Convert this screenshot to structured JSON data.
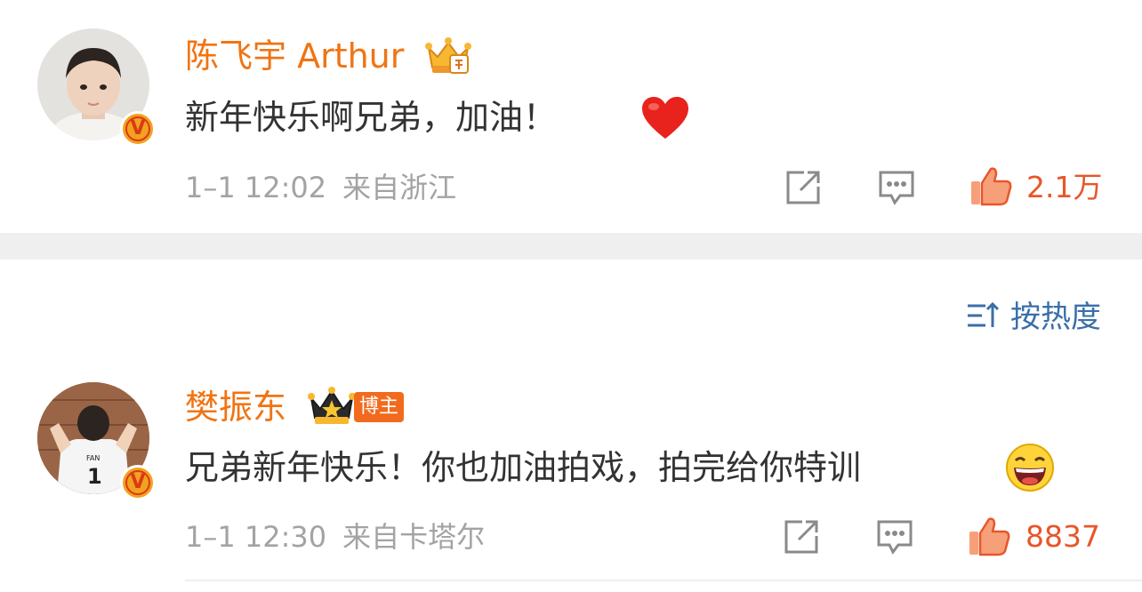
{
  "comments": [
    {
      "user_name": "陈飞宇 Arthur",
      "text": "新年快乐啊兄弟，加油！",
      "emoji_icon": "red-heart-icon",
      "date": "1–1 12:02",
      "location": "来自浙江",
      "likes": "2.1万",
      "verified_label": "V",
      "member_icon": "crown-member-icon"
    },
    {
      "user_name": "樊振东",
      "text": "兄弟新年快乐！你也加油拍戏，拍完给你特训",
      "emoji_icon": "laughing-face-icon",
      "date": "1–1 12:30",
      "location": "来自卡塔尔",
      "likes": "8837",
      "verified_label": "V",
      "member_icon": "crown-member-icon",
      "badge": "博主"
    }
  ],
  "sort": {
    "label": "按热度",
    "icon": "sort-icon"
  },
  "colors": {
    "name": "#f07413",
    "like": "#e8562a",
    "meta": "#a3a3a3",
    "sort": "#3a6fa8",
    "divider": "#efefef"
  }
}
